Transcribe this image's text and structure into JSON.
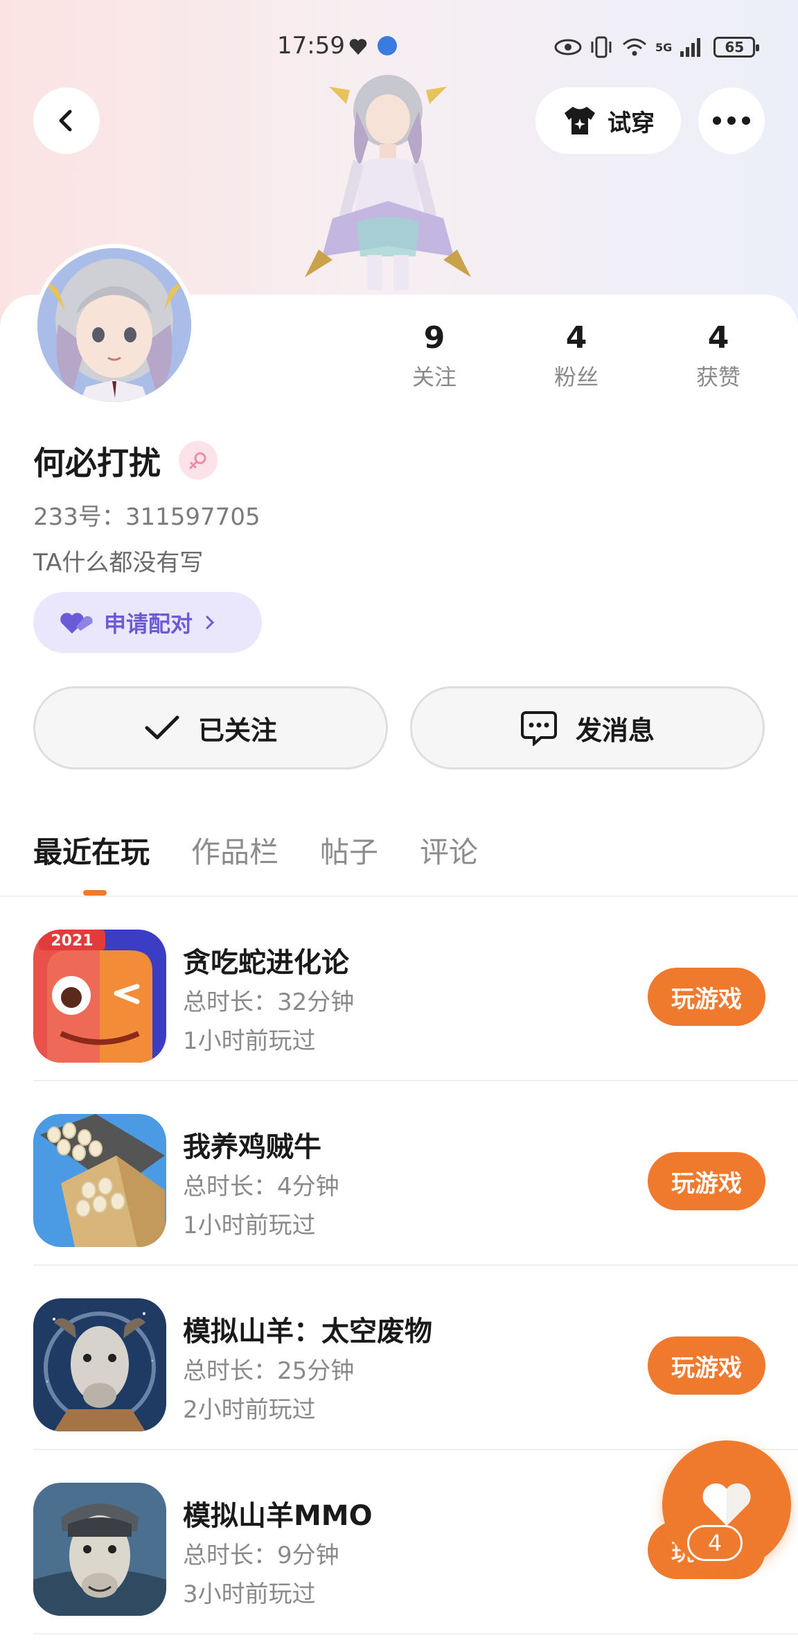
{
  "status_bar": {
    "time": "17:59",
    "network": "5G",
    "battery": "65"
  },
  "header": {
    "try_on_label": "试穿"
  },
  "profile": {
    "stats": [
      {
        "value": "9",
        "label": "关注"
      },
      {
        "value": "4",
        "label": "粉丝"
      },
      {
        "value": "4",
        "label": "获赞"
      }
    ],
    "username": "何必打扰",
    "user_id": "233号：311597705",
    "bio": "TA什么都没有写",
    "pair_label": "申请配对",
    "follow_label": "已关注",
    "message_label": "发消息"
  },
  "tabs": [
    {
      "label": "最近在玩",
      "active": true
    },
    {
      "label": "作品栏",
      "active": false
    },
    {
      "label": "帖子",
      "active": false
    },
    {
      "label": "评论",
      "active": false
    }
  ],
  "games": [
    {
      "title": "贪吃蛇进化论",
      "duration": "总时长：32分钟",
      "last_played": "1小时前玩过",
      "play_label": "玩游戏",
      "icon_badge": "2021"
    },
    {
      "title": "我养鸡贼牛",
      "duration": "总时长：4分钟",
      "last_played": "1小时前玩过",
      "play_label": "玩游戏"
    },
    {
      "title": "模拟山羊：太空废物",
      "duration": "总时长：25分钟",
      "last_played": "2小时前玩过",
      "play_label": "玩游戏"
    },
    {
      "title": "模拟山羊MMO",
      "duration": "总时长：9分钟",
      "last_played": "3小时前玩过",
      "play_label": "玩游戏"
    }
  ],
  "floating_like": {
    "count": "4"
  },
  "colors": {
    "accent": "#ef7a2e",
    "pair_purple": "#6b5bd6"
  }
}
